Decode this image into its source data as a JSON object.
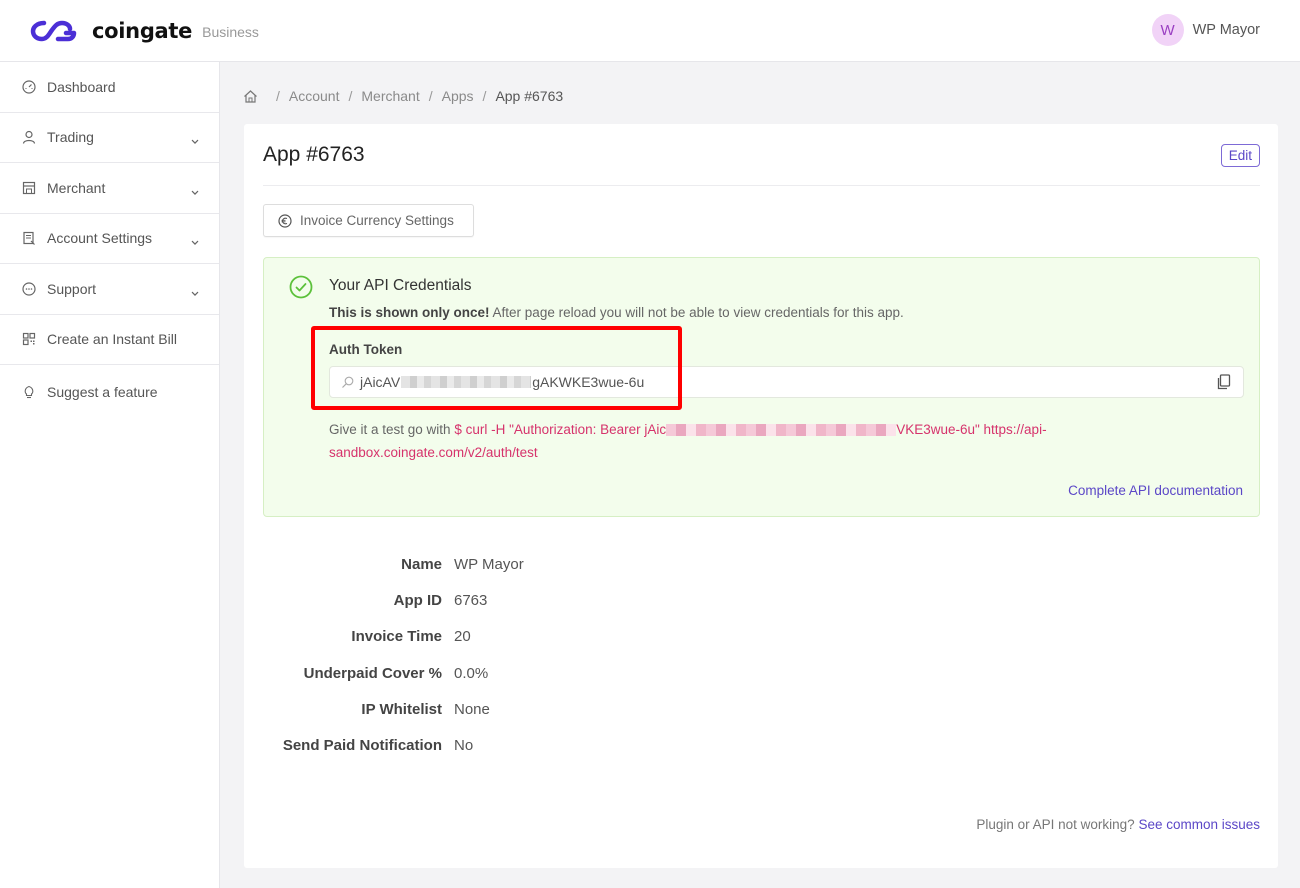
{
  "header": {
    "logo_text": "coingate",
    "logo_subtitle": "Business",
    "brand_color": "#4b2fd6",
    "user": {
      "initial": "W",
      "name": "WP Mayor"
    }
  },
  "sidebar": {
    "items": [
      {
        "label": "Dashboard",
        "icon": "gauge-icon",
        "expandable": false
      },
      {
        "label": "Trading",
        "icon": "user-icon",
        "expandable": true
      },
      {
        "label": "Merchant",
        "icon": "store-icon",
        "expandable": true
      },
      {
        "label": "Account Settings",
        "icon": "receipt-icon",
        "expandable": true
      },
      {
        "label": "Support",
        "icon": "chat-icon",
        "expandable": true
      },
      {
        "label": "Create an Instant Bill",
        "icon": "qr-code-icon",
        "expandable": false
      },
      {
        "label": "Suggest a feature",
        "icon": "lightbulb-icon",
        "expandable": false
      }
    ]
  },
  "breadcrumb": {
    "items": [
      "Account",
      "Merchant",
      "Apps",
      "App #6763"
    ]
  },
  "page": {
    "title": "App #6763",
    "edit_label": "Edit",
    "currency_settings_label": "Invoice Currency Settings"
  },
  "credentials": {
    "title": "Your API Credentials",
    "note_bold": "This is shown only once!",
    "note_rest": " After page reload you will not be able to view credentials for this app.",
    "auth_token_label": "Auth Token",
    "token_visible_start": "jAicAV",
    "token_visible_end": "gAKWKE3wue-6u",
    "test_prefix": "Give it a test go with ",
    "test_cmd_start": "$ curl -H \"Authorization: Bearer jAic",
    "test_cmd_end": "VKE3wue-6u\" https://api-sandbox.coingate.com/v2/auth/test",
    "doc_link": "Complete API documentation",
    "accent_success": "#5cc13b",
    "code_color": "#d6336c"
  },
  "details": [
    {
      "label": "Name",
      "value": "WP Mayor"
    },
    {
      "label": "App ID",
      "value": "6763"
    },
    {
      "label": "Invoice Time",
      "value": "20"
    },
    {
      "label": "Underpaid Cover %",
      "value": "0.0%"
    },
    {
      "label": "IP Whitelist",
      "value": "None"
    },
    {
      "label": "Send Paid Notification",
      "value": "No"
    }
  ],
  "footer": {
    "text": "Plugin or API not working? ",
    "link": "See common issues"
  }
}
